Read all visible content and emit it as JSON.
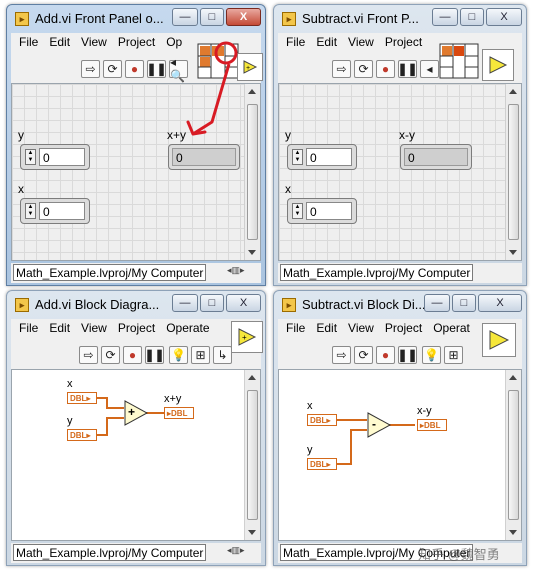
{
  "menu_items": [
    "File",
    "Edit",
    "View",
    "Project",
    "Operate"
  ],
  "status_path": "Math_Example.lvproj/My Computer",
  "windows": {
    "add_fp": {
      "title": "Add.vi Front Panel o...",
      "menu": [
        "File",
        "Edit",
        "View",
        "Project",
        "Op"
      ],
      "inputs": [
        {
          "label": "y",
          "value": "0"
        },
        {
          "label": "x",
          "value": "0"
        }
      ],
      "output": {
        "label": "x+y",
        "value": "0"
      }
    },
    "sub_fp": {
      "title": "Subtract.vi Front P...",
      "menu": [
        "File",
        "Edit",
        "View",
        "Project"
      ],
      "inputs": [
        {
          "label": "y",
          "value": "0"
        },
        {
          "label": "x",
          "value": "0"
        }
      ],
      "output": {
        "label": "x-y",
        "value": "0"
      }
    },
    "add_bd": {
      "title": "Add.vi Block Diagra...",
      "menu": [
        "File",
        "Edit",
        "View",
        "Project",
        "Operate"
      ],
      "terminal_in_x": "x",
      "terminal_in_y": "y",
      "terminal_out": "x+y",
      "term_type": "DBL",
      "operator": "+"
    },
    "sub_bd": {
      "title": "Subtract.vi Block Di...",
      "menu": [
        "File",
        "Edit",
        "View",
        "Project",
        "Operat"
      ],
      "terminal_in_x": "x",
      "terminal_in_y": "y",
      "terminal_out": "x-y",
      "term_type": "DBL",
      "operator": "-"
    }
  },
  "watermark": "知乎 @魏智勇",
  "colors": {
    "annotation": "#d81b24",
    "terminal": "#d4691a",
    "window_frame": "#aac4e0"
  }
}
